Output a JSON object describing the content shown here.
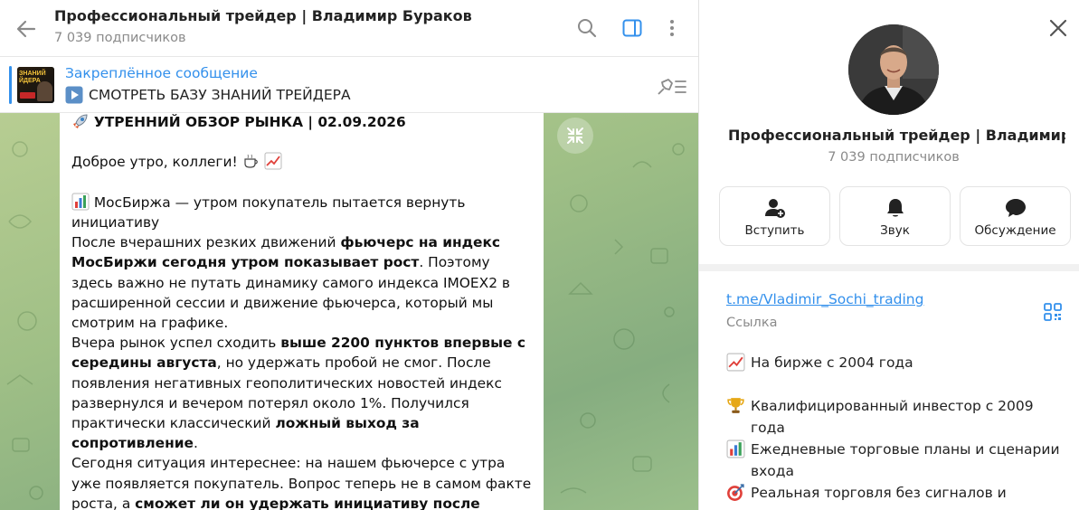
{
  "header": {
    "title": "Профессиональный трейдер | Владимир Бураков",
    "subtitle": "7 039 подписчиков"
  },
  "pinned": {
    "label": "Закреплённое сообщение",
    "thumb_text_1": "ЗНАНИЙ",
    "thumb_text_2": "ЙДЕРА",
    "text": "СМОТРЕТЬ БАЗУ ЗНАНИЙ ТРЕЙДЕРА"
  },
  "message": {
    "title": "УТРЕННИЙ ОБЗОР РЫНКА | 02.09.2026",
    "greeting": "Доброе утро, коллеги!",
    "p1": "МосБиржа — утром покупатель пытается вернуть инициативу",
    "p2_a": "После вчерашних резких движений ",
    "p2_b": "фьючерс на индекс МосБиржи сегодня утром показывает рост",
    "p2_c": ". Поэтому здесь важно не путать динамику самого индекса IMOEX2 в расширенной сессии и движение фьючерса, который мы смотрим на графике.",
    "p3_a": "Вчера рынок успел сходить ",
    "p3_b": "выше 2200 пунктов впервые с середины августа",
    "p3_c": ", но удержать пробой не смог. После появления негативных геополитических новостей индекс развернулся и вечером потерял около 1%. Получился практически классический ",
    "p3_d": "ложный выход за сопротивление",
    "p3_e": ".",
    "p4_a": "Сегодня ситуация интереснее: на нашем фьючерсе с утра уже появляется покупатель. Вопрос теперь не в самом факте роста, а ",
    "p4_b": "сможет ли он удержать инициативу после открытия основной сессии",
    "p4_c": "."
  },
  "info": {
    "name": "Профессиональный трейдер | Владимир Бураков",
    "subscribers": "7 039 подписчиков",
    "actions": {
      "join": "Вступить",
      "sound": "Звук",
      "discussion": "Обсуждение"
    },
    "link": "t.me/Vladimir_Sochi_trading",
    "link_caption": "Ссылка",
    "desc": {
      "line1": "На бирже с 2004 года",
      "line2": "Квалифицированный инвестор с 2009 года",
      "line3": "Ежедневные торговые планы и сценарии входа",
      "line4": "Реальная торговля без сигналов и угадывания"
    }
  },
  "colors": {
    "accent": "#3390ec",
    "muted": "#8a8a8a",
    "wallpaper": "#9fbf86"
  },
  "icons": [
    "back-arrow-icon",
    "search-icon",
    "sidebar-toggle-icon",
    "more-vert-icon",
    "play-button-icon",
    "unpin-icon",
    "rocket-icon",
    "coffee-icon",
    "chart-up-icon",
    "bar-chart-icon",
    "collapse-icon",
    "close-icon",
    "add-user-icon",
    "bell-icon",
    "chat-bubble-icon",
    "qr-code-icon",
    "trophy-icon",
    "target-icon"
  ]
}
